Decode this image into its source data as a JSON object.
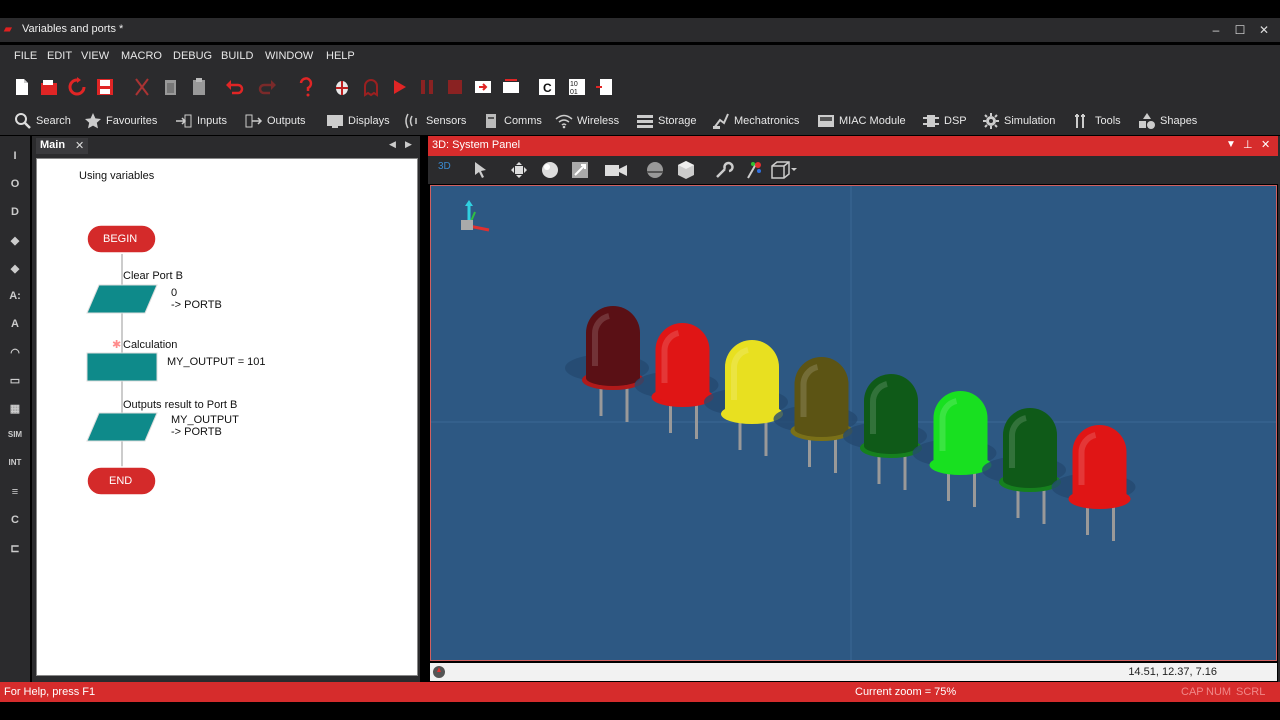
{
  "window": {
    "title": "Variables and ports *",
    "minimize": "–",
    "maximize": "☐",
    "close": "✕"
  },
  "menu": [
    "FILE",
    "EDIT",
    "VIEW",
    "MACRO",
    "DEBUG",
    "BUILD",
    "WINDOW",
    "HELP"
  ],
  "categories": [
    {
      "label": "Search",
      "icon": "search-icon"
    },
    {
      "label": "Favourites",
      "icon": "star-icon"
    },
    {
      "label": "Inputs",
      "icon": "input-icon"
    },
    {
      "label": "Outputs",
      "icon": "output-icon"
    },
    {
      "label": "Displays",
      "icon": "display-icon"
    },
    {
      "label": "Sensors",
      "icon": "sensor-icon"
    },
    {
      "label": "Comms",
      "icon": "comms-icon"
    },
    {
      "label": "Wireless",
      "icon": "wireless-icon"
    },
    {
      "label": "Storage",
      "icon": "storage-icon"
    },
    {
      "label": "Mechatronics",
      "icon": "mechatronics-icon"
    },
    {
      "label": "MIAC Module",
      "icon": "miac-icon"
    },
    {
      "label": "DSP",
      "icon": "dsp-icon"
    },
    {
      "label": "Simulation",
      "icon": "gear-icon"
    },
    {
      "label": "Tools",
      "icon": "tools-icon"
    },
    {
      "label": "Shapes",
      "icon": "shapes-icon"
    }
  ],
  "left_tools": [
    "I",
    "O",
    "D",
    "◆",
    "◆",
    "A:",
    "A",
    "◠",
    "▭",
    "▦",
    "SIM",
    "INT",
    "≡",
    "C",
    "⊏"
  ],
  "main_tab": {
    "label": "Main",
    "close": "✕"
  },
  "flowchart": {
    "title": "Using variables",
    "begin": "BEGIN",
    "end": "END",
    "step1_name": "Clear Port B",
    "step1_body": "0\n-> PORTB",
    "step2_name": "Calculation",
    "step2_body": "MY_OUTPUT = 101",
    "step3_name": "Outputs result to Port B",
    "step3_body": "MY_OUTPUT\n-> PORTB"
  },
  "system_panel": {
    "title": "3D: System Panel",
    "view_label": "3D",
    "coordinates": "14.51, 12.37, 7.16",
    "leds": [
      {
        "color": "dark-red",
        "hex": "#5a1015",
        "rim": "#b01a1a"
      },
      {
        "color": "red",
        "hex": "#e01515",
        "rim": "#e01515"
      },
      {
        "color": "yellow",
        "hex": "#e8e020",
        "rim": "#e8e020"
      },
      {
        "color": "dark-yellow",
        "hex": "#5c5414",
        "rim": "#7a7018"
      },
      {
        "color": "dark-green",
        "hex": "#0f5a18",
        "rim": "#16801e"
      },
      {
        "color": "green",
        "hex": "#18e020",
        "rim": "#18e020"
      },
      {
        "color": "dark-green",
        "hex": "#0f5a18",
        "rim": "#16801e"
      },
      {
        "color": "red",
        "hex": "#e01515",
        "rim": "#e01515"
      }
    ]
  },
  "status": {
    "help": "For Help, press F1",
    "zoom": "Current zoom = 75%",
    "cap": "CAP",
    "num": "NUM",
    "scrl": "SCRL"
  },
  "colors": {
    "accent": "#d62c2c",
    "panel_bg": "#2b2b2d",
    "scene_bg": "#2d5883",
    "flow_teal": "#0e8a8a",
    "terminator": "#d42a2a"
  }
}
